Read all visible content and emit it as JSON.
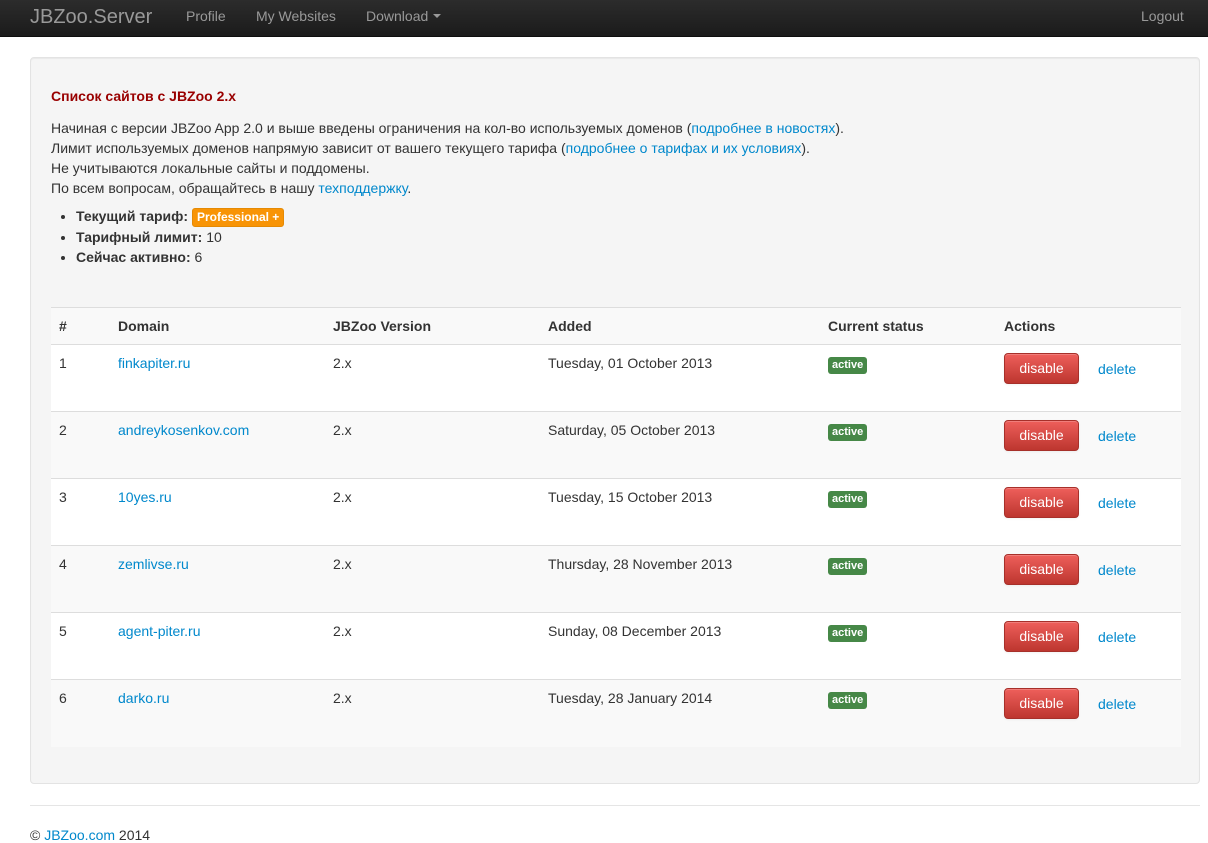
{
  "navbar": {
    "brand": "JBZoo.Server",
    "items": [
      {
        "label": "Profile"
      },
      {
        "label": "My Websites"
      },
      {
        "label": "Download"
      }
    ],
    "logout": "Logout"
  },
  "page": {
    "heading": "Список сайтов с JBZoo 2.x",
    "intro": {
      "line1_pre": "Начиная с версии JBZoo App 2.0 и выше введены ограничения на кол-во используемых доменов (",
      "line1_link": "подробнее в новостях",
      "line1_post": ").",
      "line2_pre": "Лимит используемых доменов напрямую зависит от вашего текущего тарифа (",
      "line2_link": "подробнее о тарифах и их условиях",
      "line2_post": ").",
      "line3": "Не учитываются локальные сайты и поддомены.",
      "line4_pre": "По всем вопросам, обращайтесь в нашу ",
      "line4_link": "техподдержку",
      "line4_post": "."
    },
    "tariff": {
      "plan_label": "Текущий тариф:",
      "plan_value": "Professional +",
      "limit_label": "Тарифный лимит:",
      "limit_value": "10",
      "active_label": "Сейчас активно:",
      "active_value": "6"
    }
  },
  "table": {
    "headers": [
      "#",
      "Domain",
      "JBZoo Version",
      "Added",
      "Current status",
      "Actions"
    ],
    "rows": [
      {
        "num": "1",
        "domain": "finkapiter.ru",
        "version": "2.x",
        "added": "Tuesday, 01 October 2013",
        "status": "active",
        "disable": "disable",
        "delete": "delete"
      },
      {
        "num": "2",
        "domain": "andreykosenkov.com",
        "version": "2.x",
        "added": "Saturday, 05 October 2013",
        "status": "active",
        "disable": "disable",
        "delete": "delete"
      },
      {
        "num": "3",
        "domain": "10yes.ru",
        "version": "2.x",
        "added": "Tuesday, 15 October 2013",
        "status": "active",
        "disable": "disable",
        "delete": "delete"
      },
      {
        "num": "4",
        "domain": "zemlivse.ru",
        "version": "2.x",
        "added": "Thursday, 28 November 2013",
        "status": "active",
        "disable": "disable",
        "delete": "delete"
      },
      {
        "num": "5",
        "domain": "agent-piter.ru",
        "version": "2.x",
        "added": "Sunday, 08 December 2013",
        "status": "active",
        "disable": "disable",
        "delete": "delete"
      },
      {
        "num": "6",
        "domain": "darko.ru",
        "version": "2.x",
        "added": "Tuesday, 28 January 2014",
        "status": "active",
        "disable": "disable",
        "delete": "delete"
      }
    ]
  },
  "footer": {
    "copyright": "©",
    "link": "JBZoo.com",
    "year": "2014"
  },
  "colors": {
    "navbar_bg": "#1b1b1b",
    "link": "#0088cc",
    "heading": "#990000",
    "plan_badge": "#f89406",
    "status_active": "#468847",
    "danger": "#da4f49"
  }
}
